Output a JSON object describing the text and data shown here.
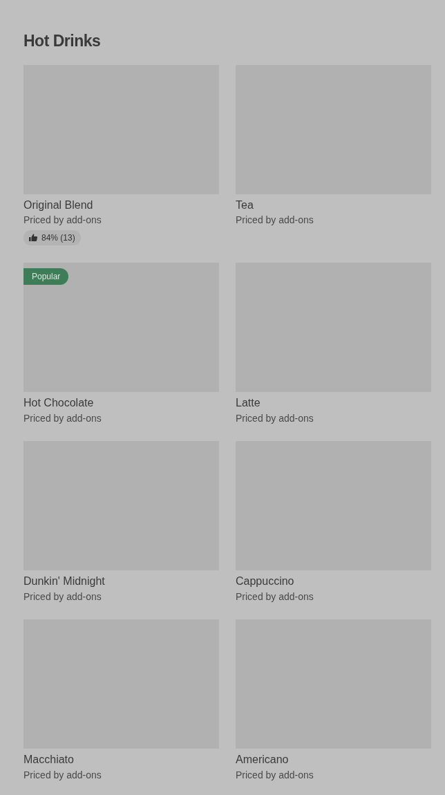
{
  "section": {
    "title": "Hot Drinks"
  },
  "items": [
    {
      "name": "Original Blend",
      "price": "Priced by add-ons",
      "rating": "84% (13)"
    },
    {
      "name": "Tea",
      "price": "Priced by add-ons"
    },
    {
      "name": "Hot Chocolate",
      "price": "Priced by add-ons",
      "badge": "Popular"
    },
    {
      "name": "Latte",
      "price": "Priced by add-ons"
    },
    {
      "name": "Dunkin' Midnight",
      "price": "Priced by add-ons"
    },
    {
      "name": "Cappuccino",
      "price": "Priced by add-ons"
    },
    {
      "name": "Macchiato",
      "price": "Priced by add-ons"
    },
    {
      "name": "Americano",
      "price": "Priced by add-ons"
    }
  ]
}
